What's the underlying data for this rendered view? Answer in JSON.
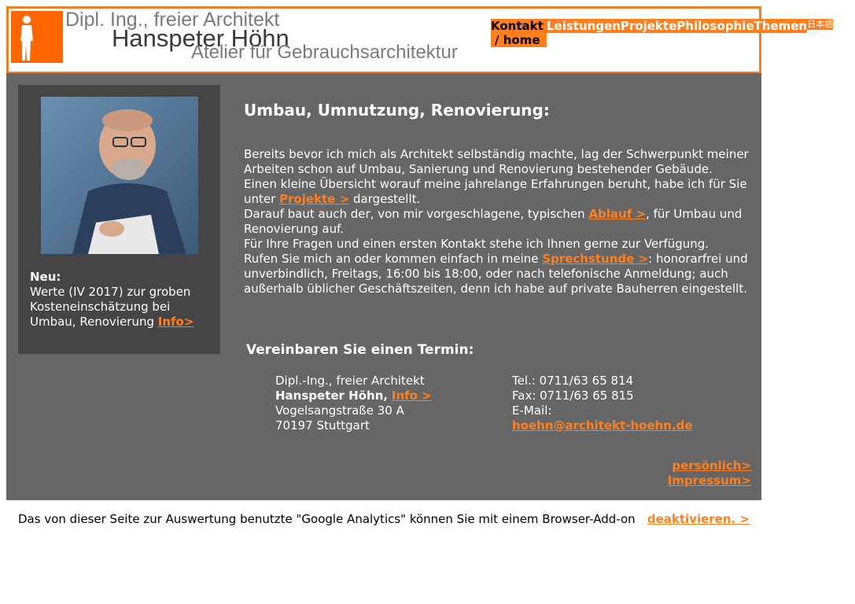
{
  "header": {
    "line1": "Dipl. Ing., freier Architekt",
    "line2": "Hanspeter Höhn",
    "line3": "Atelier für Gebrauchsarchitektur"
  },
  "nav": {
    "active_label": "Kontakt",
    "active_sub": "/ home",
    "items": [
      "Leistungen",
      "Projekte",
      "Philosophie",
      "Themen"
    ],
    "language_label": "日本語"
  },
  "sidebar": {
    "heading": "Neu:",
    "text": "Werte (IV 2017) zur groben Kosteneinschätzung bei Umbau, Renovierung",
    "link": "Info>"
  },
  "main": {
    "title": "Umbau, Umnutzung, Renovierung:",
    "p1": "Bereits bevor ich mich als Architekt selbständig machte, lag der Schwerpunkt meiner Arbeiten schon auf Umbau, Sanierung und Renovierung bestehender Gebäude.",
    "p2_before": "Einen kleine Übersicht worauf meine jahrelange Erfahrungen beruht, habe ich für Sie unter",
    "p2_link": "Projekte >",
    "p2_after": "dargestellt.",
    "p3_before": "Darauf baut auch der, von mir vorgeschlagene, typischen",
    "p3_link": "Ablauf >",
    "p3_after": ", für Umbau und Renovierung auf.",
    "p4": "Für Ihre Fragen und einen ersten Kontakt stehe ich Ihnen gerne zur Verfügung.",
    "p5_before": "Rufen Sie mich an oder kommen einfach in meine",
    "p5_link": "Sprechstunde >",
    "p5_after": ": honorarfrei und unverbindlich, Freitags, 16:00 bis 18:00, oder nach telefonische Anmeldung; auch außerhalb üblicher Geschäftszeiten, denn ich habe auf private Bauherren eingestellt.",
    "subtitle": "Vereinbaren Sie einen Termin:"
  },
  "address": {
    "line1": "Dipl.-Ing., freier Architekt",
    "name": "Hanspeter Höhn,",
    "name_link": "Info >",
    "street": "Vogelsangstraße 30 A",
    "city": "70197 Stuttgart"
  },
  "contact": {
    "tel": "Tel.: 0711/63 65 814",
    "fax": "Fax: 0711/63 65 815",
    "email_label": "E-Mail:",
    "email": "hoehn@architekt-hoehn.de"
  },
  "links": {
    "personal": "persönlich>",
    "impressum": "Impressum>"
  },
  "footer": {
    "text": "Das von dieser Seite zur Auswertung benutzte \"Google Analytics\" können Sie mit einem Browser-Add-on",
    "link": "deaktivieren. >"
  },
  "colors": {
    "accent": "#ff7f1f",
    "panel": "#666666",
    "sidebar": "#454545",
    "header_border": "#f07f2a"
  }
}
